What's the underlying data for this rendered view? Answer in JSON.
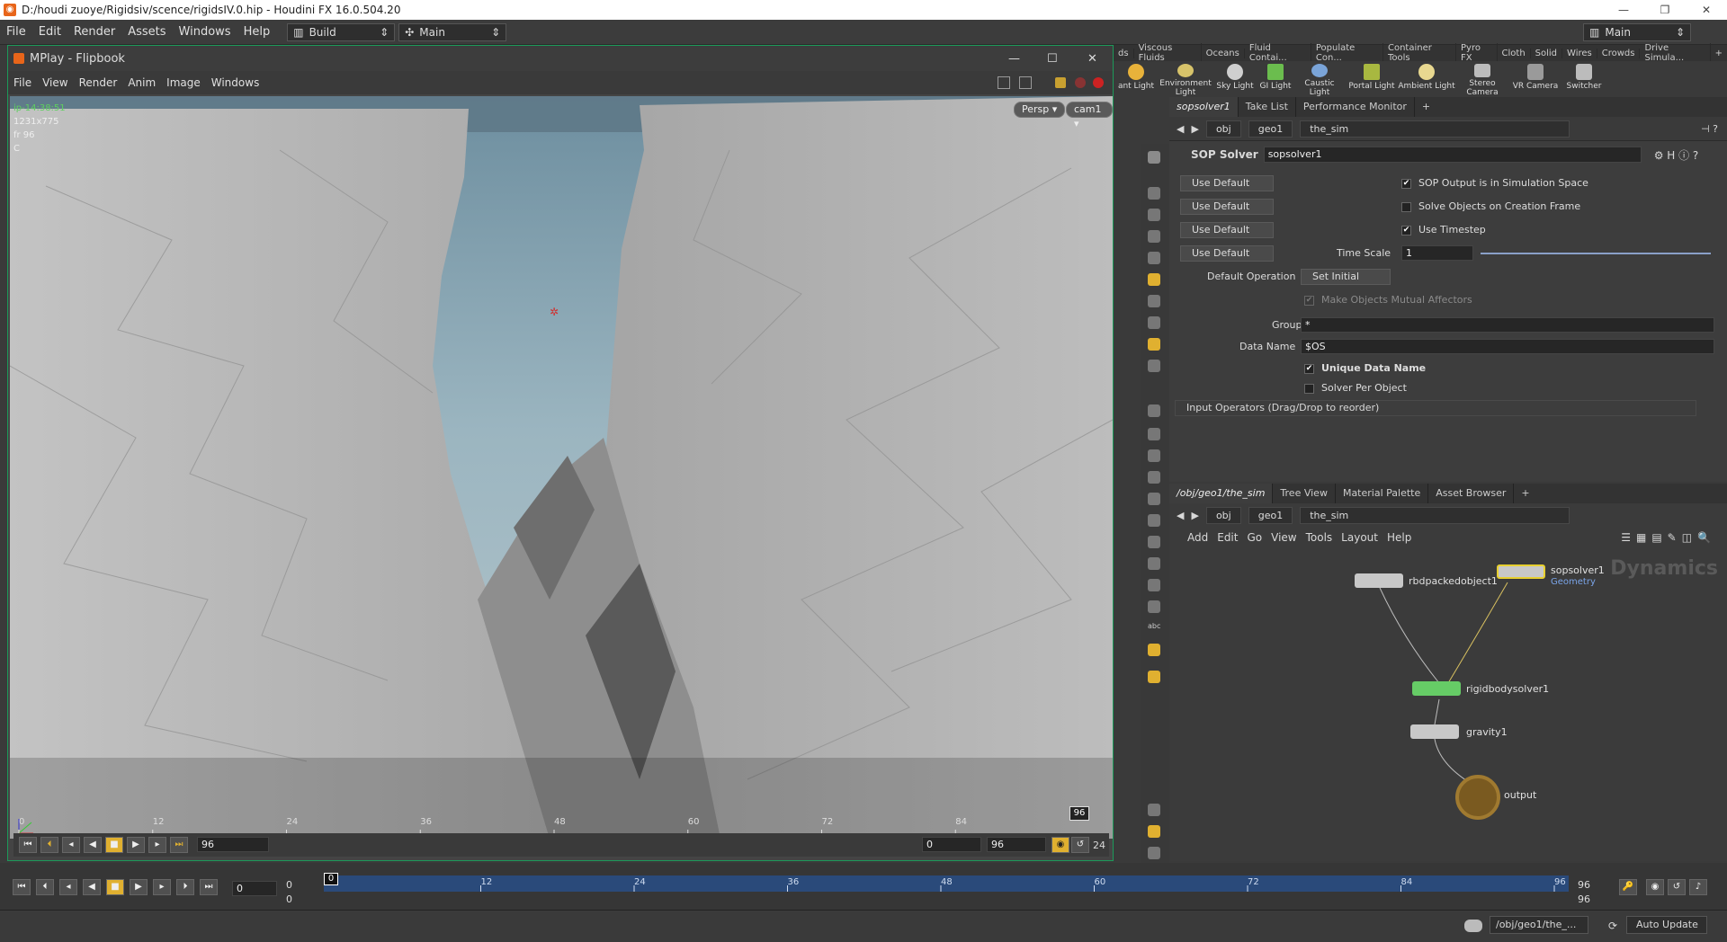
{
  "window": {
    "title": "D:/houdi  zuoye/Rigidsiv/scence/rigidsIV.0.hip - Houdini FX 16.0.504.20",
    "controls": [
      "—",
      "❐",
      "✕"
    ]
  },
  "menubar": {
    "items": [
      "File",
      "Edit",
      "Render",
      "Assets",
      "Windows",
      "Help"
    ],
    "desktop_combo": "Build",
    "context_combo": "Main",
    "right_combo": "Main"
  },
  "shelf": {
    "tabs": [
      "ds",
      "Viscous Fluids",
      "Oceans",
      "Fluid Contai...",
      "Populate Con...",
      "Container Tools",
      "Pyro FX",
      "Cloth",
      "Solid",
      "Wires",
      "Crowds",
      "Drive Simula..."
    ],
    "tools": [
      {
        "label": "ant Light",
        "color": "#e8b23a"
      },
      {
        "label": "Environment Light",
        "color": "#d7c36a"
      },
      {
        "label": "Sky Light",
        "color": "#cfcfcf"
      },
      {
        "label": "GI Light",
        "color": "#6bbd4e"
      },
      {
        "label": "Caustic Light",
        "color": "#7aa4d8"
      },
      {
        "label": "Portal Light",
        "color": "#a8b840"
      },
      {
        "label": "Ambient Light",
        "color": "#e8d890"
      },
      {
        "label": "Stereo Camera",
        "color": "#bcbcbc"
      },
      {
        "label": "VR Camera",
        "color": "#9a9a9a"
      },
      {
        "label": "Switcher",
        "color": "#bcbcbc"
      }
    ]
  },
  "flipbook": {
    "title": "MPlay - Flipbook",
    "menu": [
      "File",
      "View",
      "Render",
      "Anim",
      "Image",
      "Windows"
    ],
    "overlay": {
      "ip": "ip-14:38:51",
      "res": "1231x775",
      "frame": "fr 96",
      "channel": "C"
    },
    "persp": "Persp ▾",
    "cam": "cam1 ▾",
    "ticks": [
      "0",
      "12",
      "24",
      "36",
      "48",
      "60",
      "72",
      "84"
    ],
    "end_frame": "96",
    "current": "96",
    "range_start": "0",
    "range_end": "96",
    "fps": "24"
  },
  "params": {
    "tabs": [
      "sopsolver1",
      "Take List",
      "Performance Monitor"
    ],
    "path": [
      "obj",
      "geo1",
      "the_sim"
    ],
    "node_type": "SOP Solver",
    "node_name": "sopsolver1",
    "use_default": "Use Default",
    "sop_output": "SOP Output is in Simulation Space",
    "solve_creation": "Solve Objects on Creation Frame",
    "use_timestep": "Use Timestep",
    "time_scale_label": "Time Scale",
    "time_scale": "1",
    "default_op_label": "Default Operation",
    "default_op": "Set Initial",
    "mutual": "Make Objects Mutual Affectors",
    "group_label": "Group",
    "group": "*",
    "data_name_label": "Data Name",
    "data_name": "$OS",
    "unique": "Unique Data Name",
    "per_object": "Solver Per Object",
    "input_ops": "Input Operators (Drag/Drop to reorder)"
  },
  "network": {
    "tabs": [
      "/obj/geo1/the_sim",
      "Tree View",
      "Material Palette",
      "Asset Browser"
    ],
    "path": [
      "obj",
      "geo1",
      "the_sim"
    ],
    "menu": [
      "Add",
      "Edit",
      "Go",
      "View",
      "Tools",
      "Layout",
      "Help"
    ],
    "context": "Dynamics",
    "nodes": {
      "rbd": "rbdpackedobject1",
      "sop": "sopsolver1",
      "sop_sub": "Geometry",
      "rigid": "rigidbodysolver1",
      "gravity": "gravity1",
      "output": "output"
    }
  },
  "timeline": {
    "ticks": [
      "12",
      "24",
      "36",
      "48",
      "60",
      "72",
      "84",
      "96"
    ],
    "start": "0",
    "current_frame": "0",
    "range_a": "0",
    "range_b": "0",
    "end_a": "96",
    "end_b": "96"
  },
  "status": {
    "path": "/obj/geo1/the_...",
    "update": "Auto Update"
  }
}
